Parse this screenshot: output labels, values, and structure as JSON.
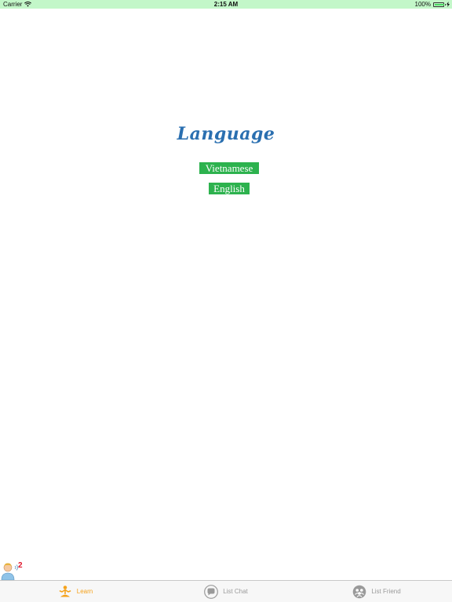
{
  "status_bar": {
    "carrier": "Carrier",
    "time": "2:15 AM",
    "battery": "100%",
    "battery_level": 1.0
  },
  "main": {
    "title": "Language",
    "buttons": {
      "vietnamese": "Vietnamese",
      "english": "English"
    }
  },
  "helper": {
    "badge": "2"
  },
  "tab_bar": {
    "tabs": [
      {
        "label": "Learn",
        "icon": "meditation-person-icon",
        "active": true
      },
      {
        "label": "List Chat",
        "icon": "chat-bubble-icon",
        "active": false
      },
      {
        "label": "List Friend",
        "icon": "friends-group-icon",
        "active": false
      }
    ]
  },
  "colors": {
    "status_bar_bg": "#c3f7c9",
    "title": "#2a6fb0",
    "button_bg": "#2db24e",
    "tab_active": "#f5a21b",
    "tab_inactive": "#9a9a9a",
    "badge": "#e0142a"
  }
}
